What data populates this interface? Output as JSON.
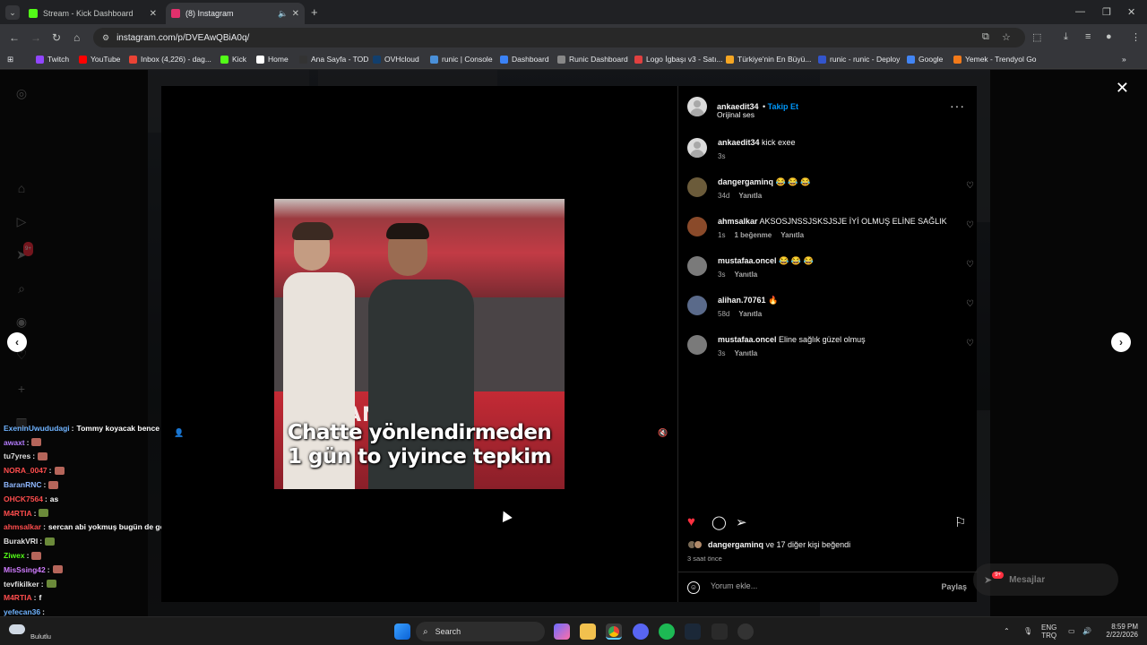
{
  "browser": {
    "tabs": [
      {
        "title": "Stream - Kick Dashboard",
        "favicon_color": "#53fc18",
        "active": false
      },
      {
        "title": "(8) Instagram",
        "favicon_color": "#e1306c",
        "active": true
      }
    ],
    "url": "instagram.com/p/DVEAwQBiA0q/",
    "bookmarks": [
      {
        "label": "Twitch",
        "color": "#9146ff"
      },
      {
        "label": "YouTube",
        "color": "#ff0000"
      },
      {
        "label": "Inbox (4,226) - dag...",
        "color": "#ea4335"
      },
      {
        "label": "Kick",
        "color": "#53fc18"
      },
      {
        "label": "Home",
        "color": "#ffffff"
      },
      {
        "label": "Ana Sayfa - TOD",
        "color": "#333333"
      },
      {
        "label": "OVHcloud",
        "color": "#123f6d"
      },
      {
        "label": "runic | Console",
        "color": "#4a90d9"
      },
      {
        "label": "Dashboard",
        "color": "#3b82f6"
      },
      {
        "label": "Runic Dashboard",
        "color": "#888888"
      },
      {
        "label": "Logo İgbaşı v3 - Satı...",
        "color": "#e04040"
      },
      {
        "label": "Türkiye'nin En Büyü...",
        "color": "#f5a623"
      },
      {
        "label": "runic - runic - Deploy",
        "color": "#3355cc"
      },
      {
        "label": "Google",
        "color": "#4285f4"
      },
      {
        "label": "Yemek - Trendyol Go",
        "color": "#f27a1a"
      }
    ]
  },
  "chat": [
    {
      "user": "ExeninUwududagi",
      "color": "#6fb3ff",
      "msg": "Tommy koyacak bence",
      "emote": ""
    },
    {
      "user": "awaxt",
      "color": "#b57cff",
      "msg": "",
      "emote": "r"
    },
    {
      "user": "tu7yres",
      "color": "#e0e0e0",
      "msg": "",
      "emote": "r"
    },
    {
      "user": "NORA_0047",
      "color": "#ff4d4d",
      "msg": "",
      "emote": "r"
    },
    {
      "user": "BaranRNC",
      "color": "#8fb8ff",
      "msg": "",
      "emote": "r"
    },
    {
      "user": "OHCK7564",
      "color": "#ff4d4d",
      "msg": "as",
      "emote": ""
    },
    {
      "user": "M4RTIA",
      "color": "#ff4d4d",
      "msg": "",
      "emote": "g"
    },
    {
      "user": "ahmsalkar",
      "color": "#ff4d4d",
      "msg": "sercan abi yokmuş bugün de gene aday olur herhalde",
      "emote": ""
    },
    {
      "user": "BurakVRI",
      "color": "#e0e0e0",
      "msg": "",
      "emote": "g"
    },
    {
      "user": "Ziwex",
      "color": "#53fc18",
      "msg": "",
      "emote": "r"
    },
    {
      "user": "MisSsing42",
      "color": "#d07cff",
      "msg": "",
      "emote": "r"
    },
    {
      "user": "tevfikilker",
      "color": "#e0e0e0",
      "msg": "",
      "emote": "g"
    },
    {
      "user": "M4RTIA",
      "color": "#ff4d4d",
      "msg": "f",
      "emote": ""
    },
    {
      "user": "yefecan36",
      "color": "#6fb3ff",
      "msg": "",
      "emote": ""
    }
  ],
  "video": {
    "caption_line1": "Chatte yönlendirmeden",
    "caption_line2": "1 gün to yiyince tepkim",
    "board_text": "ANTEP FI"
  },
  "post": {
    "author": "ankaedit34",
    "follow_label": "Takip Et",
    "audio": "Orijinal ses",
    "caption_text": "kick exee",
    "caption_time": "3s",
    "comments": [
      {
        "user": "dangergaminq",
        "text": "😂 😂 😂",
        "time": "34d",
        "likes": "",
        "reply": "Yanıtla"
      },
      {
        "user": "ahmsalkar",
        "text": "AKSOSJNSSJSKSJSJE İYİ OLMUŞ ELİNE SAĞLIK",
        "time": "1s",
        "likes": "1 beğenme",
        "reply": "Yanıtla"
      },
      {
        "user": "mustafaa.oncel",
        "text": "😂 😂 😂",
        "time": "3s",
        "likes": "",
        "reply": "Yanıtla"
      },
      {
        "user": "alihan.70761",
        "text": "🔥",
        "time": "58d",
        "likes": "",
        "reply": "Yanıtla"
      },
      {
        "user": "mustafaa.oncel",
        "text": "Eline sağlık güzel olmuş",
        "time": "3s",
        "likes": "",
        "reply": "Yanıtla"
      }
    ],
    "liked_by_user": "dangergaminq",
    "liked_by_rest": "ve 17 diğer kişi beğendi",
    "time_ago": "3 saat önce",
    "comment_placeholder": "Yorum ekle...",
    "post_label": "Paylaş"
  },
  "sidebar_badge": "9+",
  "messages": {
    "label": "Mesajlar",
    "badge": "9+"
  },
  "taskbar": {
    "weather_label": "Bulutlu",
    "search_label": "Search",
    "lang_top": "ENG",
    "lang_bottom": "TRQ",
    "time": "8:59 PM",
    "date": "2/22/2026"
  }
}
